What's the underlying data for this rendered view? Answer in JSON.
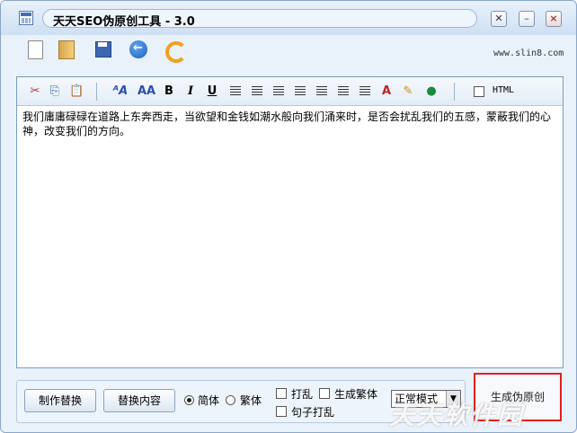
{
  "window": {
    "title": "天天SEO伪原创工具 - 3.0",
    "site": "www.slin8.com"
  },
  "main_toolbar": {
    "icons": [
      "new-document-icon",
      "open-folder-icon",
      "save-disk-icon",
      "back-arrow-icon",
      "refresh-icon"
    ]
  },
  "editor_toolbar": {
    "bold": "B",
    "italic": "I",
    "underline": "U",
    "html_label": "HTML",
    "html_checked": false
  },
  "editor": {
    "content": "我们庸庸碌碌在道路上东奔西走，当欲望和金钱如潮水般向我们涌来时，是否会扰乱我们的五感，蒙蔽我们的心神，改变我们的方向。"
  },
  "bottom": {
    "make_replace": "制作替换",
    "replace_content": "替换内容",
    "simplified": "简体",
    "traditional": "繁体",
    "simplified_selected": true,
    "shuffle": "打乱",
    "gen_traditional": "生成繁体",
    "sentence_shuffle": "句子打乱",
    "mode_value": "正常模式",
    "generate": "生成伪原创"
  },
  "watermark": "天天软件园",
  "colors": {
    "window_bg": "#e9f2fb",
    "highlight_border": "#e02020"
  }
}
